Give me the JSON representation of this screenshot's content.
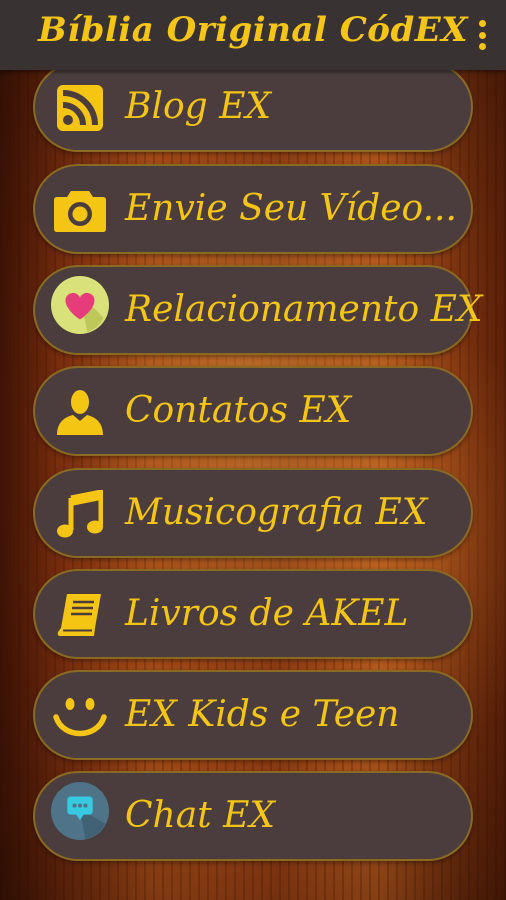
{
  "app": {
    "title": "Bíblia Original CódEX",
    "accent_color": "#f5c513",
    "topbar_color": "#393233",
    "button_color": "#4b3d3e"
  },
  "menu": {
    "items": [
      {
        "label": "Blog EX",
        "icon": "rss-feed-icon"
      },
      {
        "label": "Envie Seu Vídeo...",
        "icon": "camera-icon"
      },
      {
        "label": "Relacionamento EX",
        "icon": "heart-icon"
      },
      {
        "label": "Contatos EX",
        "icon": "person-icon"
      },
      {
        "label": "Musicografia EX",
        "icon": "music-note-icon"
      },
      {
        "label": "Livros de AKEL",
        "icon": "book-icon"
      },
      {
        "label": "EX Kids e Teen",
        "icon": "smiley-icon"
      },
      {
        "label": "Chat EX",
        "icon": "chat-bubble-icon"
      }
    ]
  }
}
